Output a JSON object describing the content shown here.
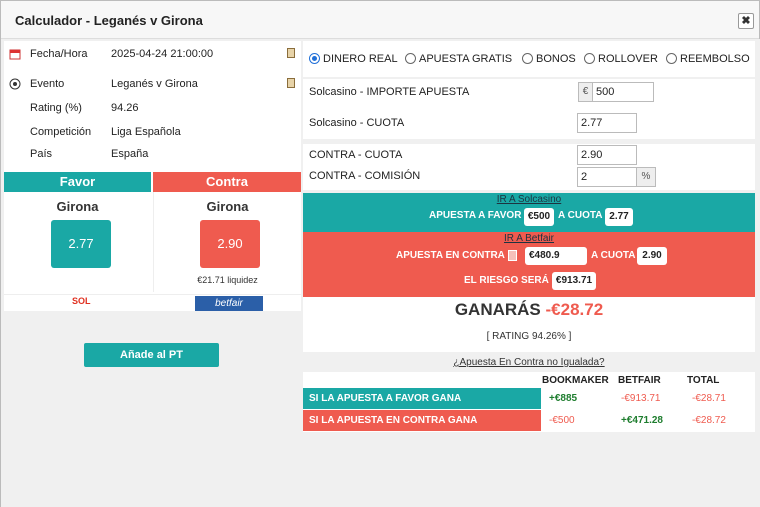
{
  "title": "Calculador - Leganés v Girona",
  "close_glyph": "✖",
  "info": [
    {
      "label": "Fecha/Hora",
      "value": "2025-04-24 21:00:00"
    },
    {
      "label": "Evento",
      "value": "Leganés v Girona"
    },
    {
      "label": "Rating (%)",
      "value": "94.26"
    },
    {
      "label": "Competición",
      "value": "Liga Española"
    },
    {
      "label": "País",
      "value": "España"
    }
  ],
  "favor": {
    "header": "Favor",
    "team": "Girona",
    "odd": "2.77",
    "logo": "SOL"
  },
  "contra": {
    "header": "Contra",
    "team": "Girona",
    "odd": "2.90",
    "liquidity": "€21.71 liquidez",
    "logo": "betfair"
  },
  "add_button": "Añade al PT",
  "modes": [
    "DINERO REAL",
    "APUESTA GRATIS",
    "BONOS",
    "ROLLOVER",
    "REEMBOLSO"
  ],
  "bookmaker": {
    "stake_label": "Solcasino - IMPORTE APUESTA",
    "currency": "€",
    "stake": "500",
    "odd_label": "Solcasino - CUOTA",
    "odd": "2.77"
  },
  "exchange": {
    "odd_label": "CONTRA - CUOTA",
    "odd": "2.90",
    "commission_label": "CONTRA - COMISIÓN",
    "commission": "2",
    "percent": "%"
  },
  "favor_box": {
    "link": "IR A Solcasino",
    "stake_text": "APUESTA A FAVOR",
    "stake": "€500",
    "odd_text": "A CUOTA",
    "odd": "2.77"
  },
  "contra_box": {
    "link": "IR A Betfair",
    "stake_text": "APUESTA EN CONTRA",
    "stake": "€480.9",
    "odd_text": "A CUOTA",
    "odd": "2.90",
    "risk_text": "EL RIESGO SERÁ",
    "risk": "€913.71"
  },
  "result": {
    "label": "GANARÁS",
    "amount": "-€28.72",
    "rating": "[ RATING 94.26% ]"
  },
  "unmatched_link": "¿Apuesta En Contra no Igualada?",
  "table": {
    "headers": [
      "BOOKMAKER",
      "BETFAIR",
      "TOTAL"
    ],
    "rows": [
      {
        "label": "SI LA APUESTA A FAVOR GANA",
        "bookmaker": "+€885",
        "betfair": "-€913.71",
        "total": "-€28.71"
      },
      {
        "label": "SI LA APUESTA EN CONTRA GANA",
        "bookmaker": "-€500",
        "betfair": "+€471.28",
        "total": "-€28.72"
      }
    ]
  },
  "colors": {
    "teal": "#1aa8a5",
    "red": "#ef5b4f"
  }
}
